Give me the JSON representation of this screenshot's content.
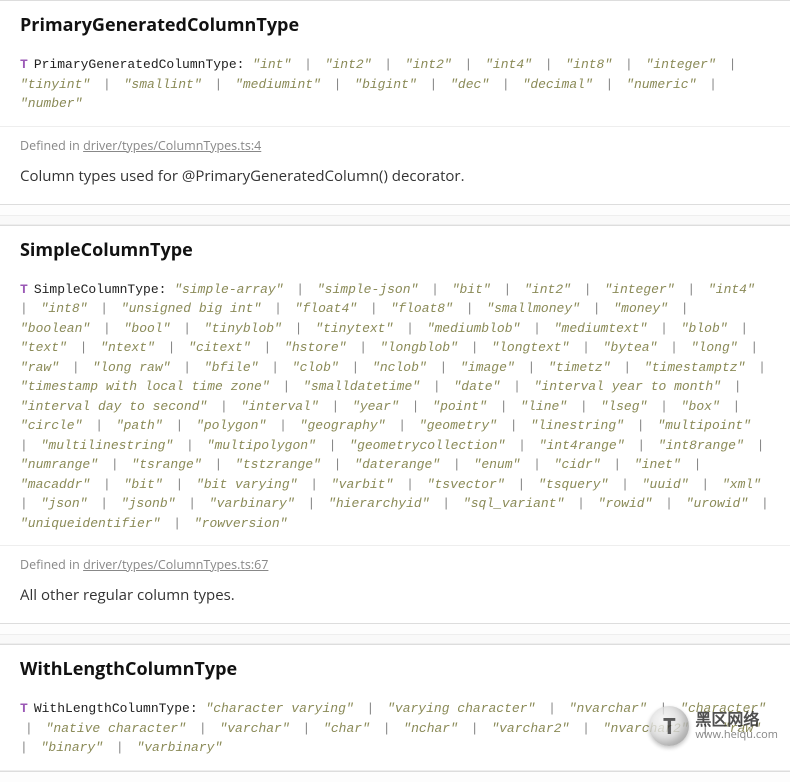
{
  "sections": [
    {
      "title": "PrimaryGeneratedColumnType",
      "icon": "T",
      "type_name": "PrimaryGeneratedColumnType",
      "values": [
        "int",
        "int2",
        "int2",
        "int4",
        "int8",
        "integer",
        "tinyint",
        "smallint",
        "mediumint",
        "bigint",
        "dec",
        "decimal",
        "numeric",
        "number"
      ],
      "defined_prefix": "Defined in ",
      "defined_link": "driver/types/ColumnTypes.ts:4",
      "description": "Column types used for @PrimaryGeneratedColumn() decorator."
    },
    {
      "title": "SimpleColumnType",
      "icon": "T",
      "type_name": "SimpleColumnType",
      "values": [
        "simple-array",
        "simple-json",
        "bit",
        "int2",
        "integer",
        "int4",
        "int8",
        "unsigned big int",
        "float4",
        "float8",
        "smallmoney",
        "money",
        "boolean",
        "bool",
        "tinyblob",
        "tinytext",
        "mediumblob",
        "mediumtext",
        "blob",
        "text",
        "ntext",
        "citext",
        "hstore",
        "longblob",
        "longtext",
        "bytea",
        "long",
        "raw",
        "long raw",
        "bfile",
        "clob",
        "nclob",
        "image",
        "timetz",
        "timestamptz",
        "timestamp with local time zone",
        "smalldatetime",
        "date",
        "interval year to month",
        "interval day to second",
        "interval",
        "year",
        "point",
        "line",
        "lseg",
        "box",
        "circle",
        "path",
        "polygon",
        "geography",
        "geometry",
        "linestring",
        "multipoint",
        "multilinestring",
        "multipolygon",
        "geometrycollection",
        "int4range",
        "int8range",
        "numrange",
        "tsrange",
        "tstzrange",
        "daterange",
        "enum",
        "cidr",
        "inet",
        "macaddr",
        "bit",
        "bit varying",
        "varbit",
        "tsvector",
        "tsquery",
        "uuid",
        "xml",
        "json",
        "jsonb",
        "varbinary",
        "hierarchyid",
        "sql_variant",
        "rowid",
        "urowid",
        "uniqueidentifier",
        "rowversion"
      ],
      "defined_prefix": "Defined in ",
      "defined_link": "driver/types/ColumnTypes.ts:67",
      "description": "All other regular column types."
    },
    {
      "title": "WithLengthColumnType",
      "icon": "T",
      "type_name": "WithLengthColumnType",
      "values": [
        "character varying",
        "varying character",
        "nvarchar",
        "character",
        "native character",
        "varchar",
        "char",
        "nchar",
        "varchar2",
        "nvarchar2",
        "raw",
        "binary",
        "varbinary"
      ],
      "defined_prefix": "",
      "defined_link": "",
      "description": ""
    }
  ],
  "watermark": {
    "glyph": "T",
    "line1": "黑区网络",
    "line2": "www.heiqu.com"
  }
}
